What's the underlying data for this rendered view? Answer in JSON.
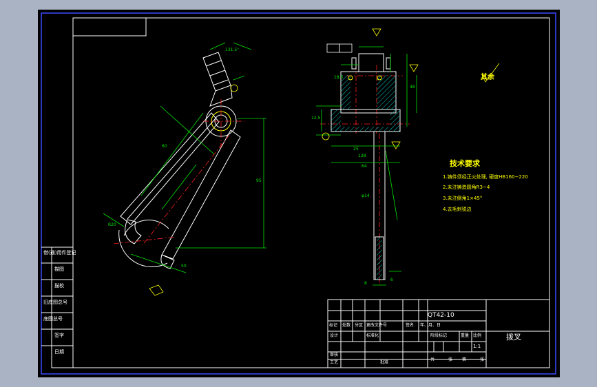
{
  "drawing": {
    "notes_title": "技术要求",
    "notes": [
      "1.铸件须经正火处理, 硬度HB160~220",
      "2.未注铸造圆角R3~4",
      "3.未注倒角1×45°",
      "4.去毛刺锐边"
    ],
    "surface_note": "其余",
    "part_number": "QT42-10",
    "part_name": "拨叉",
    "scale": "1:1",
    "revision_block": {
      "title": "借(通)用件登记",
      "rows": [
        "描图",
        "描校",
        "旧底图总号",
        "底图总号",
        "签字",
        "日期"
      ]
    },
    "title_block": {
      "header_cells": [
        "标记",
        "处数",
        "分区",
        "更改文件号",
        "签名",
        "年、月、日"
      ],
      "left_labels": [
        "设计",
        "标准化",
        "审核",
        "工艺",
        "批准"
      ],
      "stage_label": "阶段标记",
      "weight_label": "重量",
      "scale_label": "比例",
      "sheet_labels": [
        "共",
        "张",
        "第",
        "张"
      ]
    },
    "dimensions": [
      "131.5°",
      "60",
      "95",
      "50",
      "128",
      "12.5",
      "25",
      "64",
      "48",
      "18.5",
      "8",
      "6",
      "R20",
      "φ14"
    ],
    "colors": {
      "background": "#000000",
      "outline": "#ffffff",
      "dimension": "#00e600",
      "centerline": "#ff2020",
      "hatch": "#00c8c8",
      "frame": "#3a4bff",
      "annotation": "#ffff00"
    }
  }
}
